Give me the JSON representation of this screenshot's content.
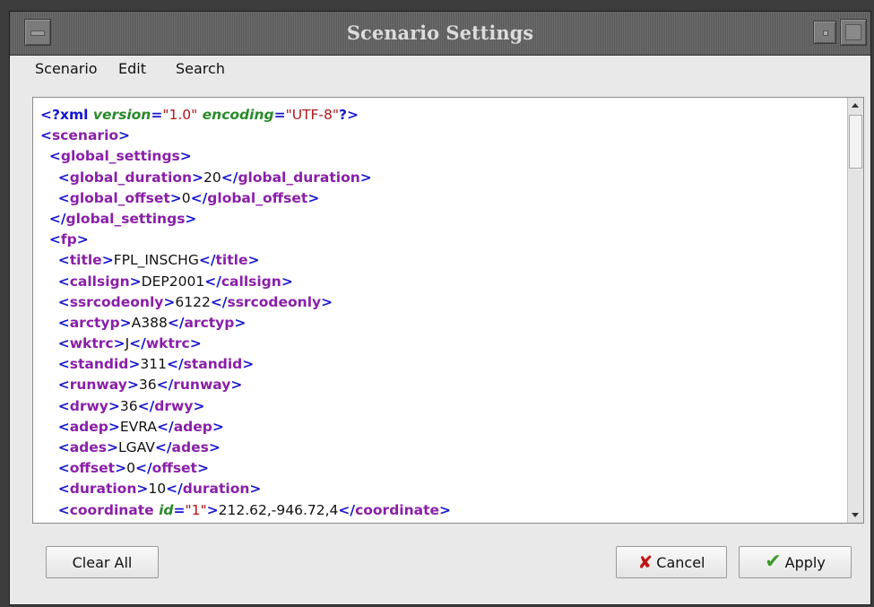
{
  "window": {
    "title": "Scenario Settings"
  },
  "menubar": {
    "items": [
      "Scenario",
      "Edit",
      "Search"
    ]
  },
  "editor": {
    "lines": [
      [
        [
          "b",
          "<?xml "
        ],
        [
          "a",
          "version"
        ],
        [
          "b",
          "="
        ],
        [
          "v",
          "\"1.0\""
        ],
        [
          "t",
          " "
        ],
        [
          "a",
          "encoding"
        ],
        [
          "b",
          "="
        ],
        [
          "v",
          "\"UTF-8\""
        ],
        [
          "b",
          "?>"
        ]
      ],
      [
        [
          "b",
          "<"
        ],
        [
          "t",
          "scenario"
        ],
        [
          "b",
          ">"
        ]
      ],
      [
        [
          "x",
          "  "
        ],
        [
          "b",
          "<"
        ],
        [
          "t",
          "global_settings"
        ],
        [
          "b",
          ">"
        ]
      ],
      [
        [
          "x",
          "    "
        ],
        [
          "b",
          "<"
        ],
        [
          "t",
          "global_duration"
        ],
        [
          "b",
          ">"
        ],
        [
          "x",
          "20"
        ],
        [
          "b",
          "</"
        ],
        [
          "t",
          "global_duration"
        ],
        [
          "b",
          ">"
        ]
      ],
      [
        [
          "x",
          "    "
        ],
        [
          "b",
          "<"
        ],
        [
          "t",
          "global_offset"
        ],
        [
          "b",
          ">"
        ],
        [
          "x",
          "0"
        ],
        [
          "b",
          "</"
        ],
        [
          "t",
          "global_offset"
        ],
        [
          "b",
          ">"
        ]
      ],
      [
        [
          "x",
          "  "
        ],
        [
          "b",
          "</"
        ],
        [
          "t",
          "global_settings"
        ],
        [
          "b",
          ">"
        ]
      ],
      [
        [
          "x",
          "  "
        ],
        [
          "b",
          "<"
        ],
        [
          "t",
          "fp"
        ],
        [
          "b",
          ">"
        ]
      ],
      [
        [
          "x",
          "    "
        ],
        [
          "b",
          "<"
        ],
        [
          "t",
          "title"
        ],
        [
          "b",
          ">"
        ],
        [
          "x",
          "FPL_INSCHG"
        ],
        [
          "b",
          "</"
        ],
        [
          "t",
          "title"
        ],
        [
          "b",
          ">"
        ]
      ],
      [
        [
          "x",
          "    "
        ],
        [
          "b",
          "<"
        ],
        [
          "t",
          "callsign"
        ],
        [
          "b",
          ">"
        ],
        [
          "x",
          "DEP2001"
        ],
        [
          "b",
          "</"
        ],
        [
          "t",
          "callsign"
        ],
        [
          "b",
          ">"
        ]
      ],
      [
        [
          "x",
          "    "
        ],
        [
          "b",
          "<"
        ],
        [
          "t",
          "ssrcodeonly"
        ],
        [
          "b",
          ">"
        ],
        [
          "x",
          "6122"
        ],
        [
          "b",
          "</"
        ],
        [
          "t",
          "ssrcodeonly"
        ],
        [
          "b",
          ">"
        ]
      ],
      [
        [
          "x",
          "    "
        ],
        [
          "b",
          "<"
        ],
        [
          "t",
          "arctyp"
        ],
        [
          "b",
          ">"
        ],
        [
          "x",
          "A388"
        ],
        [
          "b",
          "</"
        ],
        [
          "t",
          "arctyp"
        ],
        [
          "b",
          ">"
        ]
      ],
      [
        [
          "x",
          "    "
        ],
        [
          "b",
          "<"
        ],
        [
          "t",
          "wktrc"
        ],
        [
          "b",
          ">"
        ],
        [
          "x",
          "J"
        ],
        [
          "b",
          "</"
        ],
        [
          "t",
          "wktrc"
        ],
        [
          "b",
          ">"
        ]
      ],
      [
        [
          "x",
          "    "
        ],
        [
          "b",
          "<"
        ],
        [
          "t",
          "standid"
        ],
        [
          "b",
          ">"
        ],
        [
          "x",
          "311"
        ],
        [
          "b",
          "</"
        ],
        [
          "t",
          "standid"
        ],
        [
          "b",
          ">"
        ]
      ],
      [
        [
          "x",
          "    "
        ],
        [
          "b",
          "<"
        ],
        [
          "t",
          "runway"
        ],
        [
          "b",
          ">"
        ],
        [
          "x",
          "36"
        ],
        [
          "b",
          "</"
        ],
        [
          "t",
          "runway"
        ],
        [
          "b",
          ">"
        ]
      ],
      [
        [
          "x",
          "    "
        ],
        [
          "b",
          "<"
        ],
        [
          "t",
          "drwy"
        ],
        [
          "b",
          ">"
        ],
        [
          "x",
          "36"
        ],
        [
          "b",
          "</"
        ],
        [
          "t",
          "drwy"
        ],
        [
          "b",
          ">"
        ]
      ],
      [
        [
          "x",
          "    "
        ],
        [
          "b",
          "<"
        ],
        [
          "t",
          "adep"
        ],
        [
          "b",
          ">"
        ],
        [
          "x",
          "EVRA"
        ],
        [
          "b",
          "</"
        ],
        [
          "t",
          "adep"
        ],
        [
          "b",
          ">"
        ]
      ],
      [
        [
          "x",
          "    "
        ],
        [
          "b",
          "<"
        ],
        [
          "t",
          "ades"
        ],
        [
          "b",
          ">"
        ],
        [
          "x",
          "LGAV"
        ],
        [
          "b",
          "</"
        ],
        [
          "t",
          "ades"
        ],
        [
          "b",
          ">"
        ]
      ],
      [
        [
          "x",
          "    "
        ],
        [
          "b",
          "<"
        ],
        [
          "t",
          "offset"
        ],
        [
          "b",
          ">"
        ],
        [
          "x",
          "0"
        ],
        [
          "b",
          "</"
        ],
        [
          "t",
          "offset"
        ],
        [
          "b",
          ">"
        ]
      ],
      [
        [
          "x",
          "    "
        ],
        [
          "b",
          "<"
        ],
        [
          "t",
          "duration"
        ],
        [
          "b",
          ">"
        ],
        [
          "x",
          "10"
        ],
        [
          "b",
          "</"
        ],
        [
          "t",
          "duration"
        ],
        [
          "b",
          ">"
        ]
      ],
      [
        [
          "x",
          "    "
        ],
        [
          "b",
          "<"
        ],
        [
          "t",
          "coordinate "
        ],
        [
          "a",
          "id"
        ],
        [
          "b",
          "="
        ],
        [
          "v",
          "\"1\""
        ],
        [
          "b",
          ">"
        ],
        [
          "x",
          "212.62,-946.72,4"
        ],
        [
          "b",
          "</"
        ],
        [
          "t",
          "coordinate"
        ],
        [
          "b",
          ">"
        ]
      ]
    ]
  },
  "buttons": {
    "clear_all": "Clear All",
    "cancel": "Cancel",
    "apply": "Apply"
  },
  "icons": {
    "cancel": "x-icon",
    "apply": "check-icon"
  }
}
